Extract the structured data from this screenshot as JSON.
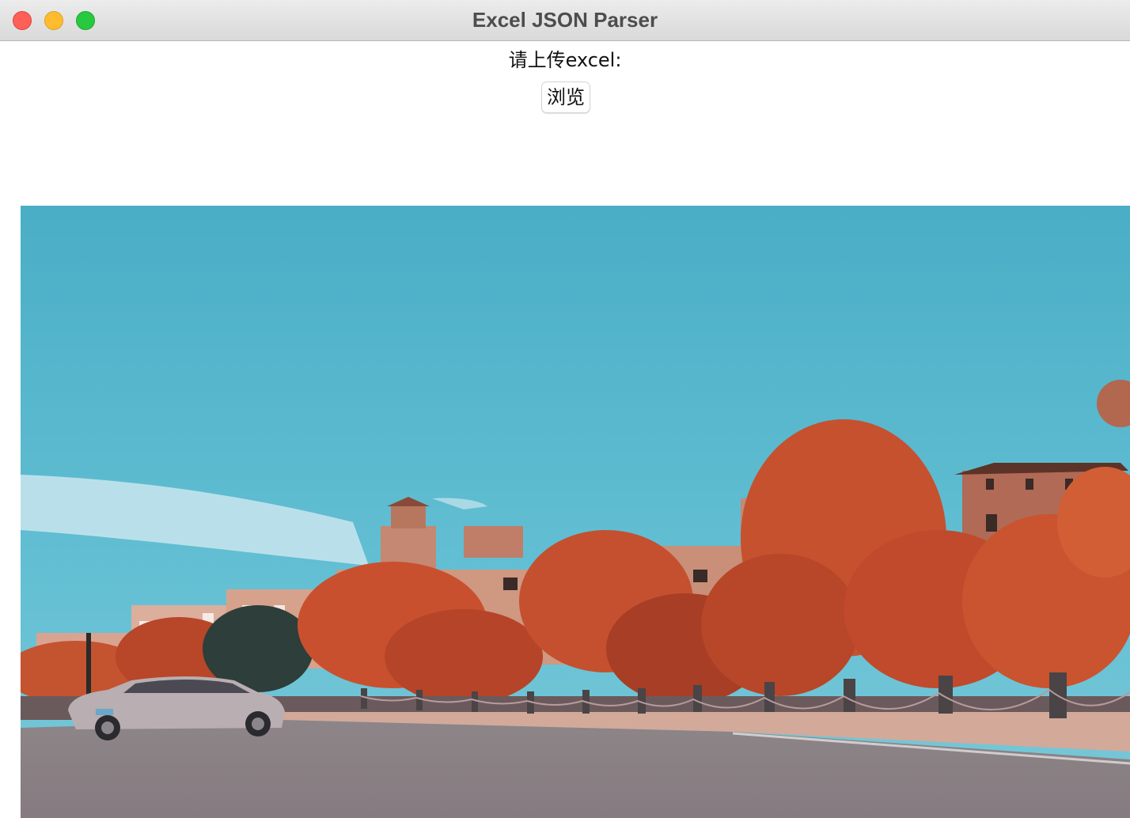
{
  "window": {
    "title": "Excel JSON Parser"
  },
  "main": {
    "upload_label": "请上传excel:",
    "browse_button_label": "浏览"
  },
  "image": {
    "subject": "autumn-trees-buildings-road-car-photo",
    "colors": {
      "sky": "#5bb7cc",
      "trees": "#c4502f",
      "buildings": "#c98f78",
      "road": "#8e8a8c"
    }
  }
}
